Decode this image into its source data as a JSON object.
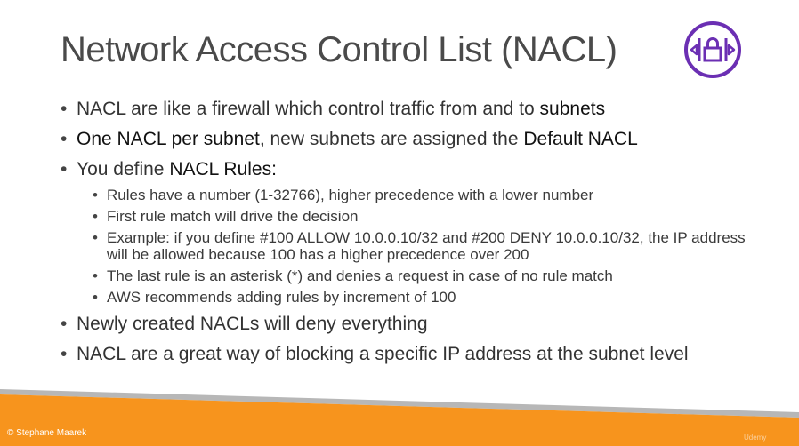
{
  "title": "Network Access Control List (NACL)",
  "logo": {
    "icon": "nacl-icon",
    "color": "#6b2fb3"
  },
  "bullets": [
    {
      "parts": [
        "NACL are like a firewall which control traffic from and to ",
        "subnets"
      ]
    },
    {
      "parts": [
        "One NACL per subnet,",
        " new subnets are assigned the ",
        "Default NACL"
      ]
    },
    {
      "parts": [
        "You define ",
        "NACL Rules:"
      ]
    },
    {
      "parts": [
        "Newly created NACLs will deny everything"
      ]
    },
    {
      "parts": [
        "NACL are a great way of blocking a specific IP address at the subnet level"
      ]
    }
  ],
  "sub_bullets": [
    "Rules have a number (1-32766), higher precedence with a lower number",
    "First rule match will drive the decision",
    "Example: if you define #100 ALLOW 10.0.0.10/32 and #200 DENY 10.0.0.10/32, the IP address will be allowed because 100 has a higher precedence over 200",
    "The last rule is an asterisk (*) and denies a request in case of no rule match",
    "AWS recommends adding rules by increment of 100"
  ],
  "footer": {
    "copyright": "© Stephane Maarek",
    "watermark": "Udemy",
    "colors": {
      "orange": "#f7941d",
      "gray": "#b7b7b7"
    }
  }
}
